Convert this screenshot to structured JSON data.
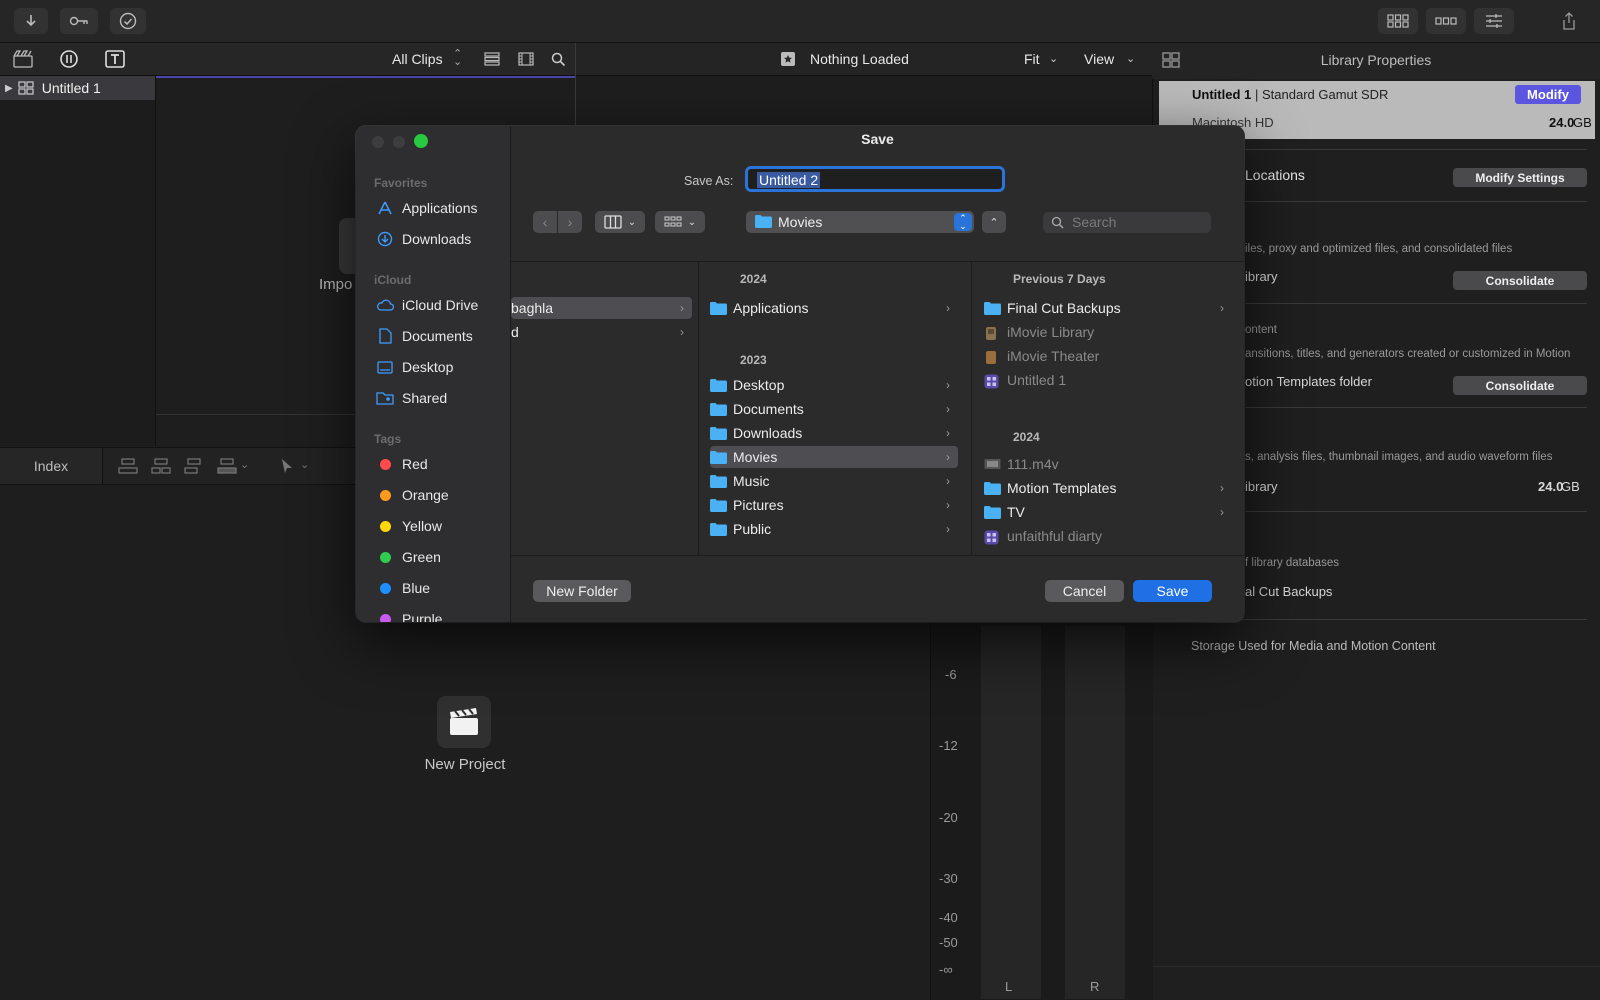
{
  "browser": {
    "clips_label": "All Clips",
    "library_name": "Untitled 1",
    "import_partial": "Impo"
  },
  "viewer": {
    "title": "Nothing Loaded",
    "fit_label": "Fit",
    "view_label": "View"
  },
  "timeline": {
    "index_label": "Index",
    "new_project_label": "New Project"
  },
  "meter": {
    "scale": [
      "-6",
      "-12",
      "-20",
      "-30",
      "-40",
      "-50",
      "-∞"
    ],
    "channels": [
      "L",
      "R"
    ]
  },
  "inspector": {
    "title": "Library Properties",
    "library_name": "Untitled 1",
    "library_format": " | Standard Gamut SDR",
    "modify_label": "Modify",
    "volume_name": "Macintosh HD",
    "volume_size": "24.0",
    "volume_unit": "GB",
    "storage_locations": "Locations",
    "modify_settings_label": "Modify Settings",
    "media_desc": "iles, proxy and optimized files, and consolidated files",
    "media_location": "ibrary",
    "consolidate_label": "Consolidate",
    "motion_heading": "ontent",
    "motion_desc": "ansitions, titles, and generators created or customized in Motion",
    "motion_location": "otion Templates folder",
    "cache_desc": "s, analysis files, thumbnail images, and audio waveform files",
    "cache_location": "ibrary",
    "cache_size": "24.0",
    "cache_unit": "GB",
    "backups_desc": "f library databases",
    "backups_location": "al Cut Backups",
    "storage_used": "Storage Used for Media and Motion Content"
  },
  "dialog": {
    "title": "Save",
    "save_as_label": "Save As:",
    "save_as_value": "Untitled 2",
    "location": "Movies",
    "search_placeholder": "Search",
    "sidebar": {
      "favorites_heading": "Favorites",
      "favorites": [
        "Applications",
        "Downloads"
      ],
      "icloud_heading": "iCloud",
      "icloud": [
        "iCloud Drive",
        "Documents",
        "Desktop",
        "Shared"
      ],
      "tags_heading": "Tags",
      "tags": [
        {
          "label": "Red",
          "color": "#ff4b4b"
        },
        {
          "label": "Orange",
          "color": "#ff9a1f"
        },
        {
          "label": "Yellow",
          "color": "#ffd60a"
        },
        {
          "label": "Green",
          "color": "#2fcc4f"
        },
        {
          "label": "Blue",
          "color": "#1e8fff"
        },
        {
          "label": "Purple",
          "color": "#c75bf0"
        }
      ]
    },
    "col1": {
      "items": [
        "baghla",
        "d"
      ]
    },
    "col2": {
      "group1_heading": "2024",
      "group1": [
        "Applications"
      ],
      "group2_heading": "2023",
      "group2": [
        "Desktop",
        "Documents",
        "Downloads",
        "Movies",
        "Music",
        "Pictures",
        "Public"
      ]
    },
    "col3": {
      "group1_heading": "Previous 7 Days",
      "group1": [
        "Final Cut Backups",
        "iMovie Library",
        "iMovie Theater",
        "Untitled 1"
      ],
      "group2_heading": "2024",
      "group2": [
        "111.m4v",
        "Motion Templates",
        "TV",
        "unfaithful diarty"
      ]
    },
    "new_folder_label": "New Folder",
    "cancel_label": "Cancel",
    "save_label": "Save",
    "accent_color": "#1f6fe5"
  }
}
